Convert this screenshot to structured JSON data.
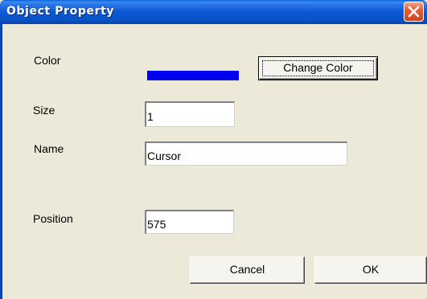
{
  "window": {
    "title": "Object Property"
  },
  "form": {
    "color_label": "Color",
    "color_value": "#0000EE",
    "change_color_label": "Change Color",
    "size_label": "Size",
    "size_value": "1",
    "name_label": "Name",
    "name_value": "Cursor",
    "position_label": "Position",
    "position_value": "575"
  },
  "buttons": {
    "cancel_label": "Cancel",
    "ok_label": "OK"
  },
  "icons": {
    "close": "close-icon"
  },
  "colors": {
    "titlebar": "#0A53C6",
    "dialog_bg": "#ECE9D8",
    "close_button": "#D2441E"
  }
}
